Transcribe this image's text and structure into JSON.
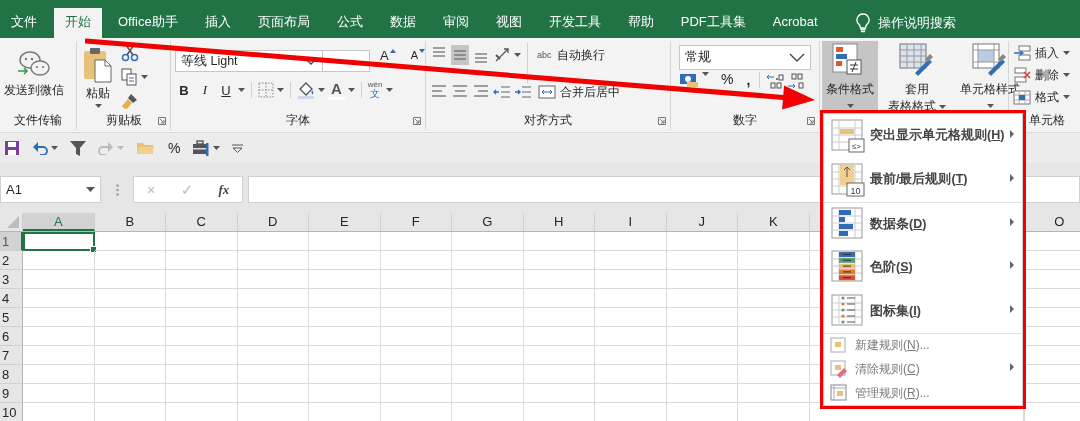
{
  "tabs": [
    {
      "label": "文件",
      "selected": false
    },
    {
      "label": "开始",
      "selected": true
    },
    {
      "label": "Office助手",
      "selected": false
    },
    {
      "label": "插入",
      "selected": false
    },
    {
      "label": "页面布局",
      "selected": false
    },
    {
      "label": "公式",
      "selected": false
    },
    {
      "label": "数据",
      "selected": false
    },
    {
      "label": "审阅",
      "selected": false
    },
    {
      "label": "视图",
      "selected": false
    },
    {
      "label": "开发工具",
      "selected": false
    },
    {
      "label": "帮助",
      "selected": false
    },
    {
      "label": "PDF工具集",
      "selected": false
    },
    {
      "label": "Acrobat",
      "selected": false
    }
  ],
  "tell_me": {
    "label": "操作说明搜索"
  },
  "ribbon": {
    "file_transfer": {
      "button": "发送到微信",
      "group_label": "文件传输"
    },
    "clipboard": {
      "paste": "粘贴",
      "group_label": "剪贴板"
    },
    "font": {
      "font_name": "等线 Light",
      "grow": "A",
      "shrink": "A",
      "styles": [
        "B",
        "I",
        "U"
      ],
      "font_color": "A",
      "phonetic": [
        "wén",
        "文"
      ],
      "group_label": "字体"
    },
    "alignment": {
      "wrap_icon": "abc",
      "wrap": "自动换行",
      "merge": "合并后居中",
      "group_label": "对齐方式"
    },
    "number": {
      "format": "常规",
      "percent": "%",
      "comma": ",",
      "group_label": "数字"
    },
    "styles": {
      "buttons": [
        {
          "lines": [
            "条件格式"
          ],
          "selected": true
        },
        {
          "lines": [
            "套用",
            "表格格式"
          ],
          "selected": false
        },
        {
          "lines": [
            "单元格样式"
          ],
          "selected": false
        }
      ]
    },
    "cells": {
      "buttons": [
        {
          "label": "插入"
        },
        {
          "label": "删除"
        },
        {
          "label": "格式"
        }
      ],
      "group_label": "单元格"
    }
  },
  "quick_access": {
    "percent": "%"
  },
  "formula_bar": {
    "name_box": "A1",
    "cancel": "×",
    "enter": "✓",
    "function": "fx"
  },
  "sheet": {
    "columns": [
      {
        "label": "A",
        "selected": true
      },
      {
        "label": "B",
        "selected": false
      },
      {
        "label": "C",
        "selected": false
      },
      {
        "label": "D",
        "selected": false
      },
      {
        "label": "E",
        "selected": false
      },
      {
        "label": "F",
        "selected": false
      },
      {
        "label": "G",
        "selected": false
      },
      {
        "label": "H",
        "selected": false
      },
      {
        "label": "I",
        "selected": false
      },
      {
        "label": "J",
        "selected": false
      },
      {
        "label": "K",
        "selected": false
      },
      {
        "label": "O",
        "selected": false
      }
    ],
    "rows": [
      {
        "label": "1",
        "selected": true
      },
      {
        "label": "2",
        "selected": false
      },
      {
        "label": "3",
        "selected": false
      },
      {
        "label": "4",
        "selected": false
      },
      {
        "label": "5",
        "selected": false
      },
      {
        "label": "6",
        "selected": false
      },
      {
        "label": "7",
        "selected": false
      },
      {
        "label": "8",
        "selected": false
      },
      {
        "label": "9",
        "selected": false
      },
      {
        "label": "10",
        "selected": false
      }
    ]
  },
  "menu": {
    "items": [
      {
        "kind": "large",
        "icon_badge": "≤>",
        "label": "突出显示单元格规则(",
        "key": "H",
        "label_end": ")",
        "submenu": true,
        "divider_above": false
      },
      {
        "kind": "large",
        "icon_badge": "10",
        "label": "最前/最后规则(",
        "key": "T",
        "label_end": ")",
        "submenu": true,
        "divider_above": false
      },
      {
        "kind": "large",
        "label": "数据条(",
        "key": "D",
        "label_end": ")",
        "submenu": true,
        "divider_above": true
      },
      {
        "kind": "large",
        "label": "色阶(",
        "key": "S",
        "label_end": ")",
        "submenu": true,
        "divider_above": false
      },
      {
        "kind": "large",
        "label": "图标集(",
        "key": "I",
        "label_end": ")",
        "submenu": true,
        "divider_above": false
      },
      {
        "kind": "small",
        "label": "新建规则(",
        "key": "N",
        "label_end": ")...",
        "submenu": false,
        "divider_above": true
      },
      {
        "kind": "small",
        "label": "清除规则(",
        "key": "C",
        "label_end": ")",
        "submenu": true,
        "divider_above": false
      },
      {
        "kind": "small",
        "label": "管理规则(",
        "key": "R",
        "label_end": ")...",
        "submenu": false,
        "divider_above": false
      }
    ]
  }
}
